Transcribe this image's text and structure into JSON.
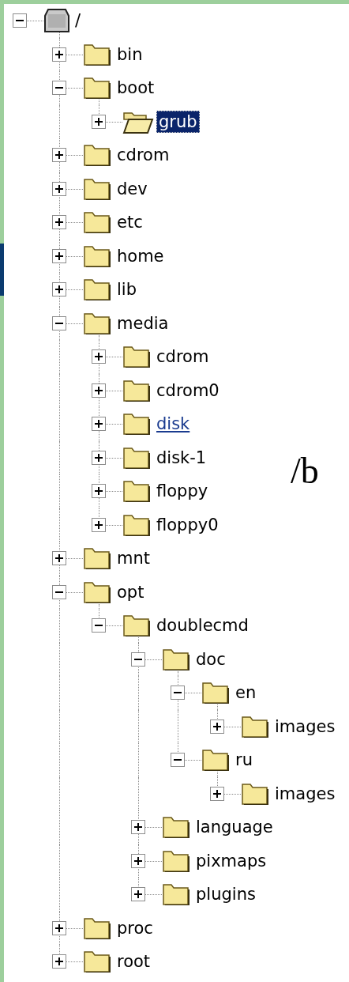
{
  "tree": {
    "label": "/",
    "kind": "drive",
    "expanded": true,
    "selected": false,
    "hover": false,
    "children": [
      {
        "label": "bin",
        "kind": "folder",
        "expanded": false,
        "selected": false,
        "hover": false
      },
      {
        "label": "boot",
        "kind": "folder",
        "expanded": true,
        "selected": false,
        "hover": false,
        "children": [
          {
            "label": "grub",
            "kind": "folder",
            "expanded": false,
            "selected": true,
            "hover": false
          }
        ]
      },
      {
        "label": "cdrom",
        "kind": "folder",
        "expanded": false,
        "selected": false,
        "hover": false
      },
      {
        "label": "dev",
        "kind": "folder",
        "expanded": false,
        "selected": false,
        "hover": false
      },
      {
        "label": "etc",
        "kind": "folder",
        "expanded": false,
        "selected": false,
        "hover": false
      },
      {
        "label": "home",
        "kind": "folder",
        "expanded": false,
        "selected": false,
        "hover": false
      },
      {
        "label": "lib",
        "kind": "folder",
        "expanded": false,
        "selected": false,
        "hover": false
      },
      {
        "label": "media",
        "kind": "folder",
        "expanded": true,
        "selected": false,
        "hover": false,
        "children": [
          {
            "label": "cdrom",
            "kind": "folder",
            "expanded": false,
            "selected": false,
            "hover": false
          },
          {
            "label": "cdrom0",
            "kind": "folder",
            "expanded": false,
            "selected": false,
            "hover": false
          },
          {
            "label": "disk",
            "kind": "folder",
            "expanded": false,
            "selected": false,
            "hover": true
          },
          {
            "label": "disk-1",
            "kind": "folder",
            "expanded": false,
            "selected": false,
            "hover": false
          },
          {
            "label": "floppy",
            "kind": "folder",
            "expanded": false,
            "selected": false,
            "hover": false
          },
          {
            "label": "floppy0",
            "kind": "folder",
            "expanded": false,
            "selected": false,
            "hover": false
          }
        ]
      },
      {
        "label": "mnt",
        "kind": "folder",
        "expanded": false,
        "selected": false,
        "hover": false
      },
      {
        "label": "opt",
        "kind": "folder",
        "expanded": true,
        "selected": false,
        "hover": false,
        "children": [
          {
            "label": "doublecmd",
            "kind": "folder",
            "expanded": true,
            "selected": false,
            "hover": false,
            "children": [
              {
                "label": "doc",
                "kind": "folder",
                "expanded": true,
                "selected": false,
                "hover": false,
                "children": [
                  {
                    "label": "en",
                    "kind": "folder",
                    "expanded": true,
                    "selected": false,
                    "hover": false,
                    "children": [
                      {
                        "label": "images",
                        "kind": "folder",
                        "expanded": false,
                        "selected": false,
                        "hover": false
                      }
                    ]
                  },
                  {
                    "label": "ru",
                    "kind": "folder",
                    "expanded": true,
                    "selected": false,
                    "hover": false,
                    "children": [
                      {
                        "label": "images",
                        "kind": "folder",
                        "expanded": false,
                        "selected": false,
                        "hover": false
                      }
                    ]
                  }
                ]
              },
              {
                "label": "language",
                "kind": "folder",
                "expanded": false,
                "selected": false,
                "hover": false
              },
              {
                "label": "pixmaps",
                "kind": "folder",
                "expanded": false,
                "selected": false,
                "hover": false
              },
              {
                "label": "plugins",
                "kind": "folder",
                "expanded": false,
                "selected": false,
                "hover": false
              }
            ]
          }
        ]
      },
      {
        "label": "proc",
        "kind": "folder",
        "expanded": false,
        "selected": false,
        "hover": false
      },
      {
        "label": "root",
        "kind": "folder",
        "expanded": false,
        "selected": false,
        "hover": false
      }
    ]
  },
  "side_text": "/b"
}
